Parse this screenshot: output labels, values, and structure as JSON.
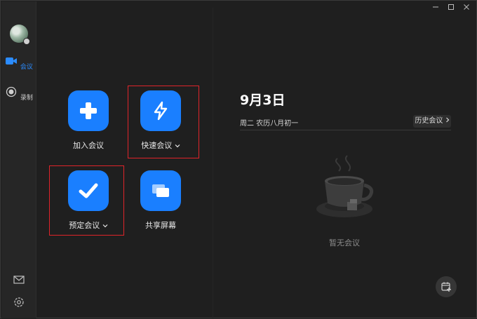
{
  "sidebar": {
    "nav": [
      {
        "label": "会议",
        "icon": "video-camera-icon",
        "active": true
      },
      {
        "label": "录制",
        "icon": "record-icon",
        "active": false
      }
    ],
    "bottom": [
      {
        "icon": "mail-icon"
      },
      {
        "icon": "gear-icon"
      }
    ]
  },
  "actions": {
    "join": {
      "label": "加入会议",
      "icon": "plus-icon"
    },
    "quick": {
      "label": "快速会议",
      "icon": "lightning-icon",
      "has_dropdown": true
    },
    "schedule": {
      "label": "预定会议",
      "icon": "checkmark-icon",
      "has_dropdown": true
    },
    "share": {
      "label": "共享屏幕",
      "icon": "share-screen-icon"
    }
  },
  "panel": {
    "date": "9月3日",
    "day_info": "周二 农历八月初一",
    "history_label": "历史会议",
    "empty_text": "暂无会议"
  },
  "colors": {
    "accent": "#1a7fff",
    "highlight": "#e0242a",
    "background": "#1f1f1f"
  }
}
